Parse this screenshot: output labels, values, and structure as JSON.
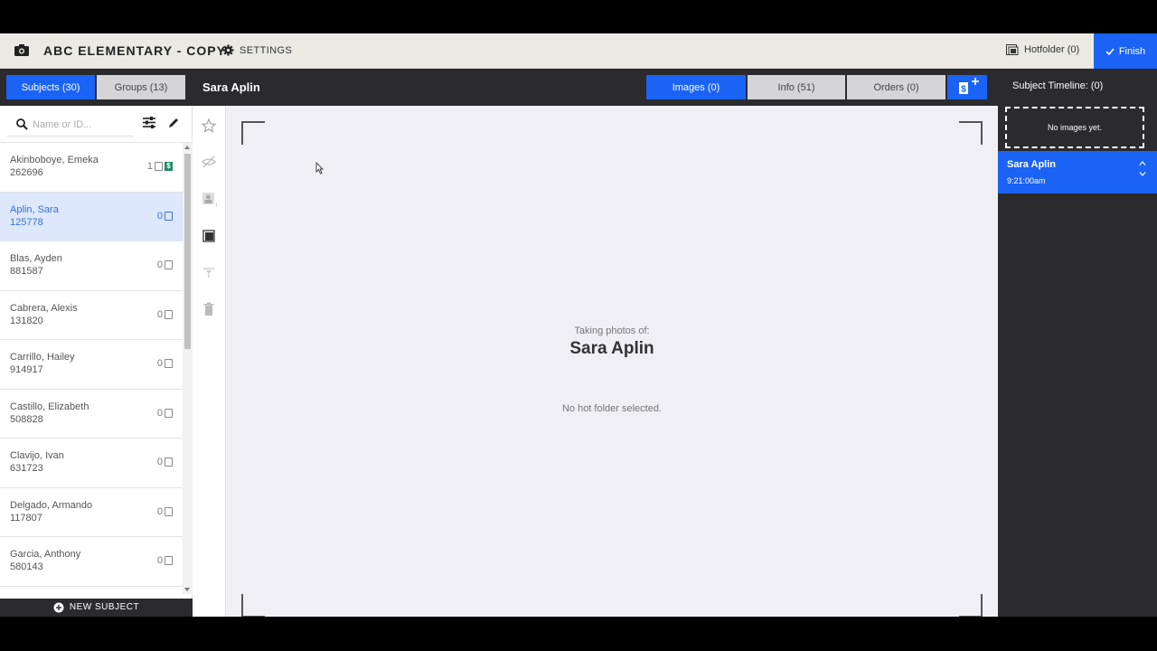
{
  "topbar": {
    "title": "ABC ELEMENTARY - COPY",
    "settings_label": "SETTINGS",
    "hotfolder_label": "Hotfolder (0)",
    "finish_label": "Finish"
  },
  "subbar": {
    "tabs_left": [
      {
        "label": "Subjects (30)",
        "active": true
      },
      {
        "label": "Groups (13)",
        "active": false
      }
    ],
    "subject_name": "Sara Aplin",
    "tabs_right": [
      {
        "label": "Images (0)",
        "active": true
      },
      {
        "label": "Info (51)",
        "active": false
      },
      {
        "label": "Orders (0)",
        "active": false
      }
    ],
    "add_icon": "money-plus-icon"
  },
  "search": {
    "placeholder": "Name or ID..."
  },
  "subjects": [
    {
      "name": "Akinboboye, Emeka",
      "id": "262696",
      "count": "1",
      "paid": true,
      "selected": false
    },
    {
      "name": "Aplin, Sara",
      "id": "125778",
      "count": "0",
      "paid": false,
      "selected": true
    },
    {
      "name": "Blas, Ayden",
      "id": "881587",
      "count": "0",
      "paid": false,
      "selected": false
    },
    {
      "name": "Cabrera, Alexis",
      "id": "131820",
      "count": "0",
      "paid": false,
      "selected": false
    },
    {
      "name": "Carrillo, Hailey",
      "id": "914917",
      "count": "0",
      "paid": false,
      "selected": false
    },
    {
      "name": "Castillo, Elizabeth",
      "id": "508828",
      "count": "0",
      "paid": false,
      "selected": false
    },
    {
      "name": "Clavijo, Ivan",
      "id": "631723",
      "count": "0",
      "paid": false,
      "selected": false
    },
    {
      "name": "Delgado, Armando",
      "id": "117807",
      "count": "0",
      "paid": false,
      "selected": false
    },
    {
      "name": "Garcia, Anthony",
      "id": "580143",
      "count": "0",
      "paid": false,
      "selected": false
    }
  ],
  "new_subject_label": "NEW SUBJECT",
  "canvas": {
    "taking_label": "Taking photos of:",
    "subject_name": "Sara Aplin",
    "hotfolder_status": "No hot folder selected."
  },
  "timeline": {
    "header": "Subject Timeline: (0)",
    "empty_label": "No images yet.",
    "entry_name": "Sara Aplin",
    "entry_time": "9:21:00am"
  },
  "colors": {
    "accent": "#1b63f5",
    "dark": "#2b2a2d",
    "selected_row": "#dde8fd",
    "paid_badge": "#1d8a66"
  }
}
